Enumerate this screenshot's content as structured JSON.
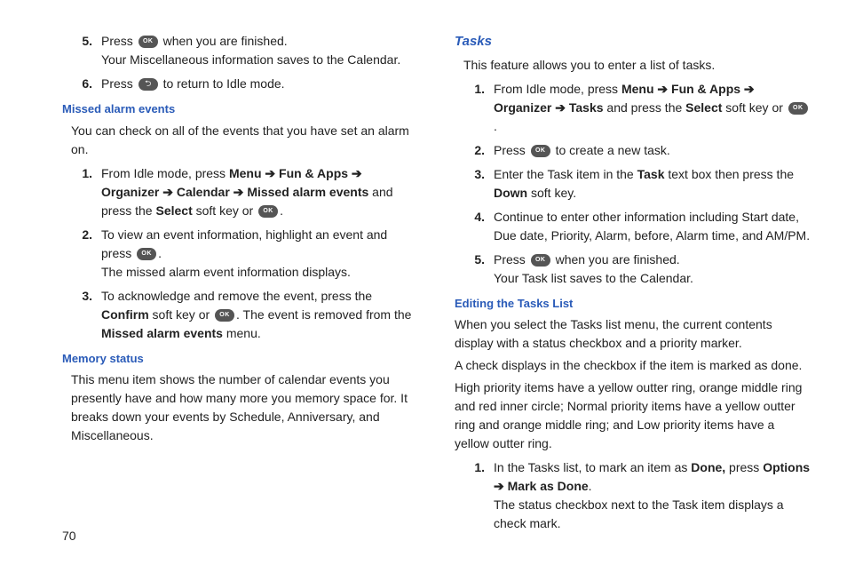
{
  "pageNumber": "70",
  "left": {
    "pressFinish": {
      "num": "5.",
      "a": "Press ",
      "b": " when you are finished.",
      "c": "Your Miscellaneous information saves to the Calendar."
    },
    "returnIdle": {
      "num": "6.",
      "a": "Press ",
      "b": " to return to Idle mode."
    },
    "missedHeading": "Missed alarm events",
    "missedIntro": "You can check on all of the events that you have set an alarm on.",
    "m1": {
      "num": "1.",
      "a": "From Idle mode, press ",
      "menu": "Menu",
      "arr1": " ➔ ",
      "fun": "Fun & Apps",
      "arr2": " ➔ ",
      "org": "Organizer",
      "arr3": " ➔ ",
      "cal": "Calendar",
      "arr4": " ➔ ",
      "mae": "Missed alarm events",
      "b": " and press the ",
      "sel": "Select",
      "c": " soft key or ",
      "d": "."
    },
    "m2": {
      "num": "2.",
      "a": "To view an event information, highlight an event and press ",
      "b": ".",
      "c": "The missed alarm event information displays."
    },
    "m3": {
      "num": "3.",
      "a": "To acknowledge and remove the event, press the ",
      "conf": "Confirm",
      "b": " soft key or ",
      "c": ". The event is removed from the ",
      "mae": "Missed alarm events",
      "d": " menu."
    },
    "memHeading": "Memory status",
    "memPara": "This menu item shows the number of calendar events you presently have and how many more you memory space for. It breaks down your events by Schedule, Anniversary, and Miscellaneous."
  },
  "right": {
    "tasksHeading": "Tasks",
    "tasksIntro": "This feature allows you to enter a list of tasks.",
    "t1": {
      "num": "1.",
      "a": "From Idle mode, press ",
      "menu": "Menu",
      "arr1": " ➔ ",
      "fun": "Fun & Apps",
      "arr2": " ➔ ",
      "org": "Organizer",
      "arr3": " ➔ ",
      "tasks": "Tasks",
      "b": " and press the ",
      "sel": "Select",
      "c": " soft key or ",
      "d": "."
    },
    "t2": {
      "num": "2.",
      "a": "Press ",
      "b": " to create a new task."
    },
    "t3": {
      "num": "3.",
      "a": "Enter the Task item in the ",
      "task": "Task",
      "b": " text box then press the ",
      "down": "Down",
      "c": " soft key."
    },
    "t4": {
      "num": "4.",
      "a": "Continue to enter other information including Start date, Due date, Priority, Alarm, before, Alarm time, and AM/PM."
    },
    "t5": {
      "num": "5.",
      "a": "Press ",
      "b": " when you are finished.",
      "c": "Your Task list saves to the Calendar."
    },
    "editHeading": "Editing the Tasks List",
    "editP1": "When you select the Tasks list menu, the current contents display with a status checkbox and a priority marker.",
    "editP2": "A check displays in the checkbox if the item is marked as done.",
    "editP3": "High priority items have a yellow outter ring, orange middle ring and red inner circle; Normal priority items have a yellow outter ring and orange middle ring; and Low priority items have a yellow outter ring.",
    "e1": {
      "num": "1.",
      "a": "In the Tasks list, to mark an item as ",
      "done": "Done,",
      "b": " press ",
      "opt": "Options",
      "arr": " ➔ ",
      "mad": "Mark as Done",
      "c": ".",
      "d": "The status checkbox next to the Task item displays a check mark."
    }
  }
}
